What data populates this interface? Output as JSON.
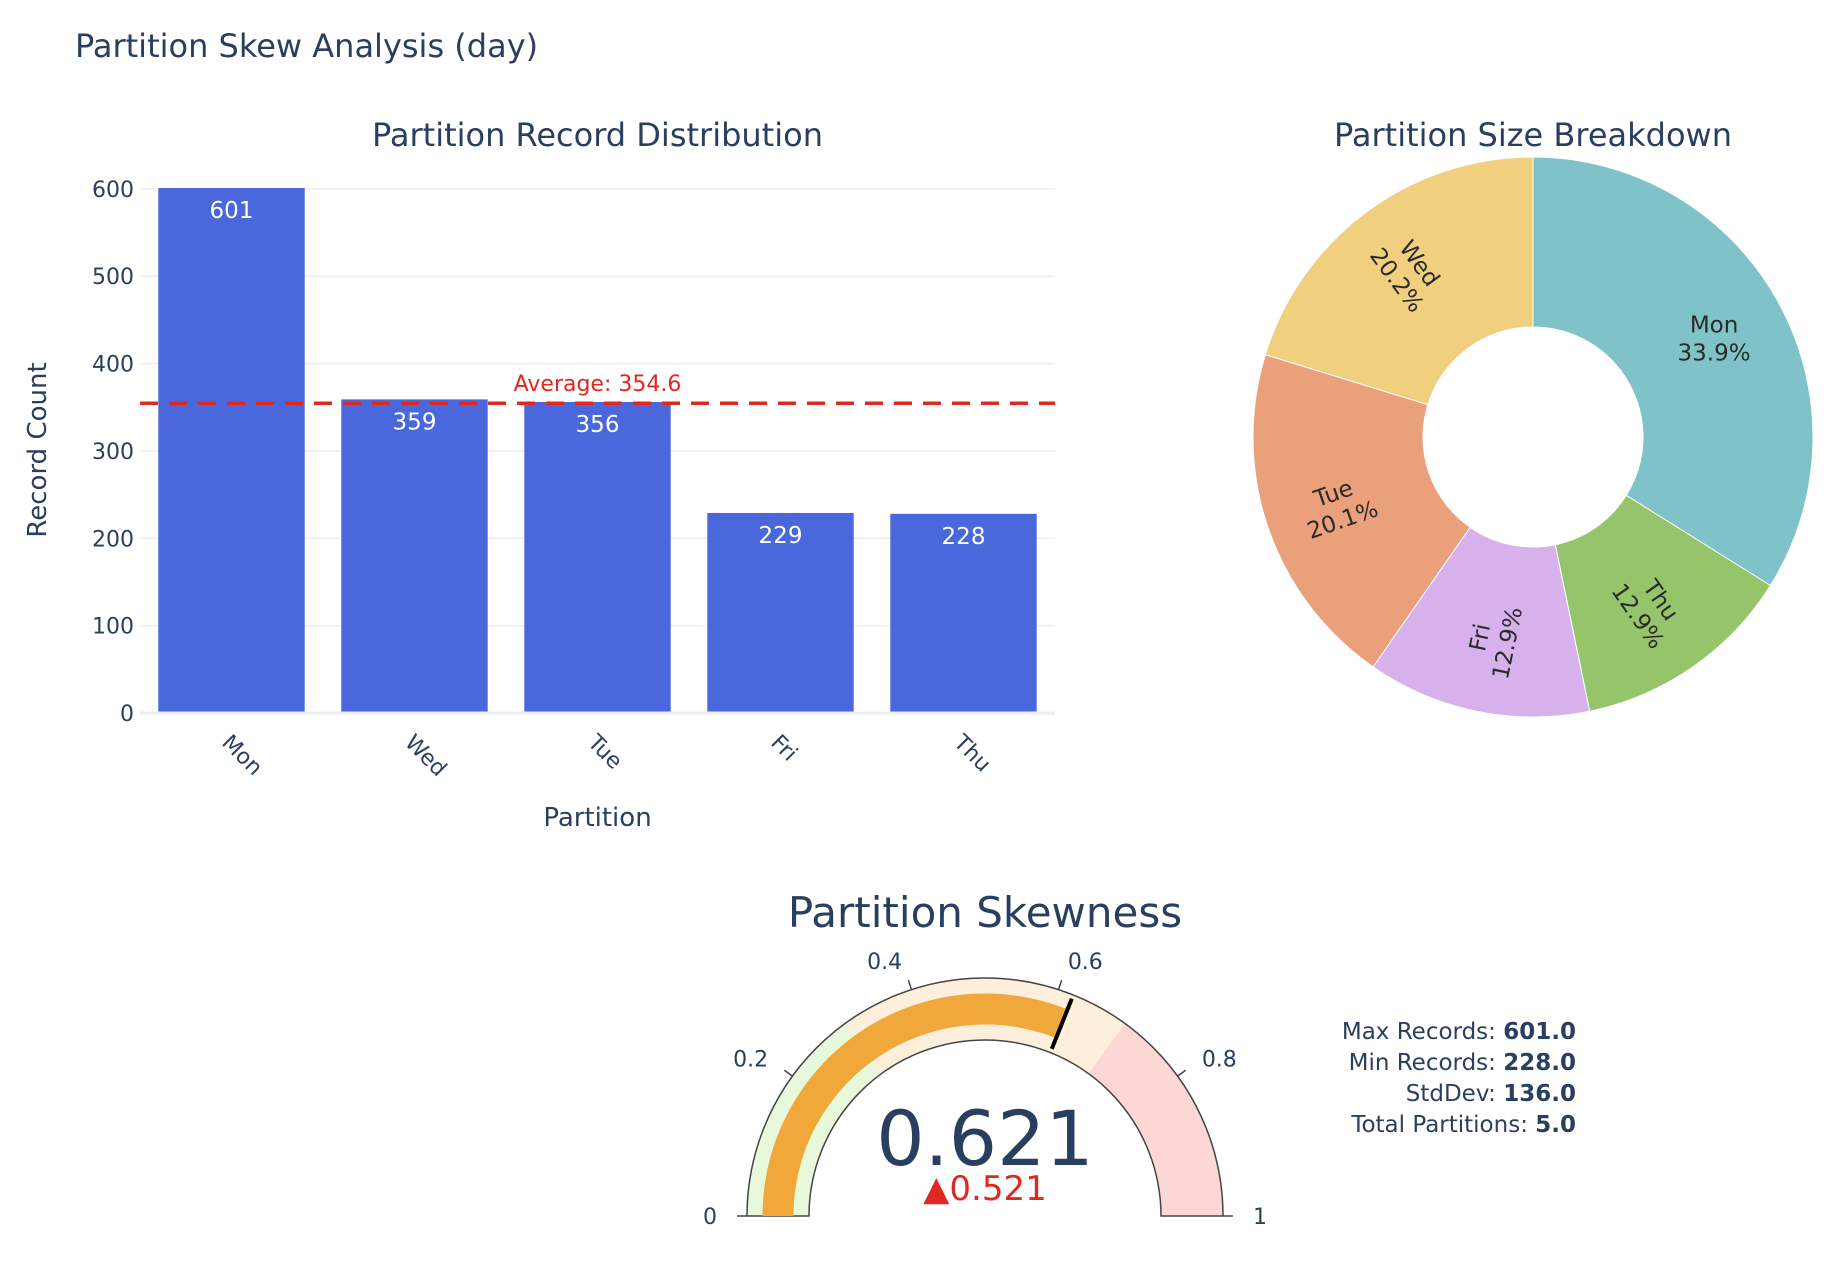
{
  "title": "Partition Skew Analysis (day)",
  "colors": {
    "text": "#2a3f5f",
    "bar": "#4a68db",
    "grid": "#ebeef4",
    "average_line": "#e0281e",
    "gauge_bar": "#f0a83a",
    "delta": "#e0281e"
  },
  "chart_data": [
    {
      "type": "bar",
      "title": "Partition Record Distribution",
      "xlabel": "Partition",
      "ylabel": "Record Count",
      "categories": [
        "Mon",
        "Wed",
        "Tue",
        "Fri",
        "Thu"
      ],
      "values": [
        601,
        359,
        356,
        229,
        228
      ],
      "data_labels": [
        "601",
        "359",
        "356",
        "229",
        "228"
      ],
      "ylim": [
        0,
        601
      ],
      "yticks": [
        0,
        100,
        200,
        300,
        400,
        500,
        600
      ],
      "ytick_labels": [
        "0",
        "100",
        "200",
        "300",
        "400",
        "500",
        "600"
      ],
      "grid": true,
      "average": {
        "value": 354.6,
        "label": "Average: 354.6"
      }
    },
    {
      "type": "pie",
      "title": "Partition Size Breakdown",
      "hole": true,
      "slices": [
        {
          "label": "Mon",
          "value": 601,
          "percent_label": "33.9%",
          "color": "#7fc3c8"
        },
        {
          "label": "Thu",
          "value": 228,
          "percent_label": "12.9%",
          "color": "#95c46b"
        },
        {
          "label": "Fri",
          "value": 229,
          "percent_label": "12.9%",
          "color": "#d6b1ec"
        },
        {
          "label": "Tue",
          "value": 356,
          "percent_label": "20.1%",
          "color": "#eba07c"
        },
        {
          "label": "Wed",
          "value": 359,
          "percent_label": "20.2%",
          "color": "#f0cf7f"
        }
      ]
    },
    {
      "type": "gauge",
      "title": "Partition Skewness",
      "value": 0.621,
      "value_label": "0.621",
      "delta_label": "▲0.521",
      "range": [
        0,
        1
      ],
      "ticks": [
        0,
        0.2,
        0.4,
        0.6,
        0.8,
        1
      ],
      "tick_labels": [
        "0",
        "0.2",
        "0.4",
        "0.6",
        "0.8",
        "1"
      ],
      "threshold": 0.621,
      "steps": [
        {
          "range": [
            0,
            0.3
          ],
          "color": "#e8f8da"
        },
        {
          "range": [
            0.3,
            0.7
          ],
          "color": "#fdefdc"
        },
        {
          "range": [
            0.7,
            1
          ],
          "color": "#fdd7d5"
        }
      ]
    }
  ],
  "stats": [
    {
      "label": "Max Records: ",
      "value": "601.0"
    },
    {
      "label": "Min Records: ",
      "value": "228.0"
    },
    {
      "label": "StdDev: ",
      "value": "136.0"
    },
    {
      "label": "Total Partitions: ",
      "value": "5.0"
    }
  ]
}
